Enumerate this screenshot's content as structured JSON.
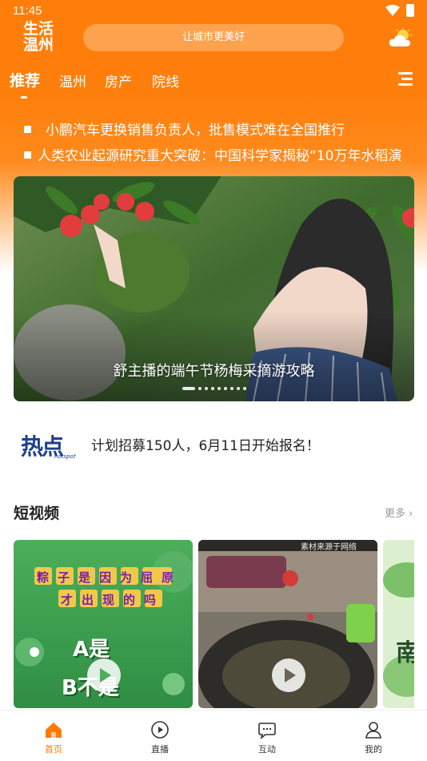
{
  "status_bar": {
    "time": "11:45"
  },
  "header": {
    "logo_line1": "生活",
    "logo_line2": "温州",
    "search_placeholder": "让城市更美好",
    "weather_icon": "partly-cloudy-icon"
  },
  "nav": {
    "tabs": [
      {
        "label": "推荐",
        "active": true
      },
      {
        "label": "温州",
        "active": false
      },
      {
        "label": "房产",
        "active": false
      },
      {
        "label": "院线",
        "active": false
      }
    ],
    "menu_icon": "menu-icon"
  },
  "headlines": [
    "小鹏汽车更换销售负责人，批售模式难在全国推行",
    "人类农业起源研究重大突破：中国科学家揭秘“10万年水稻演"
  ],
  "banner": {
    "caption": "舒主播的端午节杨梅采摘游攻略",
    "dot_count": 9,
    "active_dot": 0
  },
  "hotspot": {
    "logo_text": "热点",
    "logo_sub": "hotspot",
    "text": "计划招募150人，6月11日开始报名！"
  },
  "short_video": {
    "title": "短视频",
    "more": "更多",
    "videos": [
      {
        "line1": "粽子是因为屈原",
        "line2": "才出现的吗",
        "quiz_a": "A是",
        "quiz_b": "B不是"
      },
      {
        "watermark": "素材来源于网络"
      },
      {
        "partial_text": "南"
      }
    ]
  },
  "bottom_nav": [
    {
      "label": "首页",
      "icon": "home-icon",
      "active": true
    },
    {
      "label": "直播",
      "icon": "play-icon",
      "active": false
    },
    {
      "label": "互动",
      "icon": "chat-icon",
      "active": false
    },
    {
      "label": "我的",
      "icon": "user-icon",
      "active": false
    }
  ],
  "colors": {
    "accent": "#ff7a00",
    "header": "#ff7d0a"
  }
}
